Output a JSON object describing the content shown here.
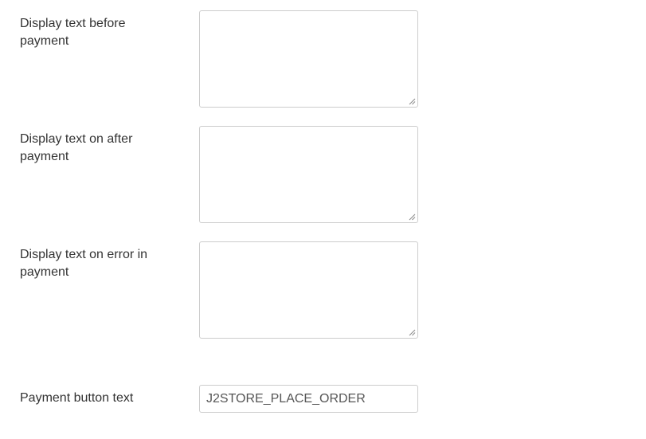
{
  "fields": [
    {
      "label": "Display text before payment",
      "value": ""
    },
    {
      "label": "Display text on after payment",
      "value": ""
    },
    {
      "label": "Display text on error in payment",
      "value": ""
    }
  ],
  "payment_button": {
    "label": "Payment button text",
    "value": "J2STORE_PLACE_ORDER"
  }
}
